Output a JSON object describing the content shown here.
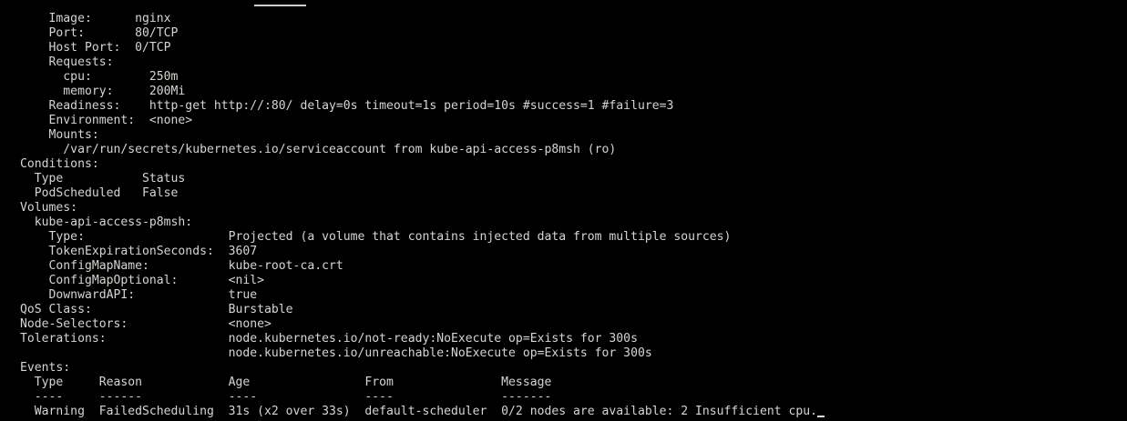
{
  "terminal": {
    "lines": [
      "    Image:      nginx",
      "    Port:       80/TCP",
      "    Host Port:  0/TCP",
      "    Requests:",
      "      cpu:        250m",
      "      memory:     200Mi",
      "    Readiness:    http-get http://:80/ delay=0s timeout=1s period=10s #success=1 #failure=3",
      "    Environment:  <none>",
      "    Mounts:",
      "      /var/run/secrets/kubernetes.io/serviceaccount from kube-api-access-p8msh (ro)",
      "Conditions:",
      "  Type           Status",
      "  PodScheduled   False",
      "Volumes:",
      "  kube-api-access-p8msh:",
      "    Type:                    Projected (a volume that contains injected data from multiple sources)",
      "    TokenExpirationSeconds:  3607",
      "    ConfigMapName:           kube-root-ca.crt",
      "    ConfigMapOptional:       <nil>",
      "    DownwardAPI:             true",
      "QoS Class:                   Burstable",
      "Node-Selectors:              <none>",
      "Tolerations:                 node.kubernetes.io/not-ready:NoExecute op=Exists for 300s",
      "                             node.kubernetes.io/unreachable:NoExecute op=Exists for 300s",
      "Events:",
      "  Type     Reason            Age                From               Message",
      "  ----     ------            ----               ----               -------",
      "  Warning  FailedScheduling  31s (x2 over 33s)  default-scheduler  0/2 nodes are available: 2 Insufficient cpu."
    ]
  }
}
